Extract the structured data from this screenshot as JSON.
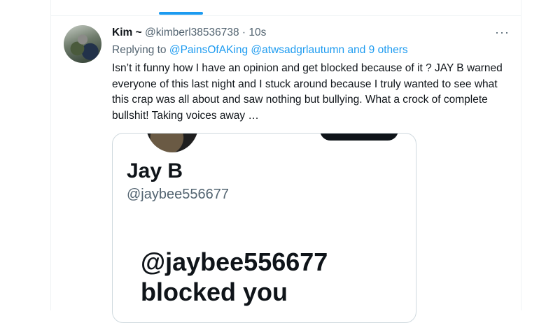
{
  "tweet": {
    "author_name": "Kim ~",
    "author_handle": "@kimberl38536738",
    "separator": " · ",
    "timestamp": "10s",
    "more_label": "···",
    "replying_prefix": "Replying to",
    "replying_to_1": "@PainsOfAKing",
    "replying_to_2": "@atwsadgrlautumn",
    "replying_others": "and 9 others",
    "text": "Isn’t it funny how I have an opinion and get blocked because of it ? JAY B warned everyone of this last night and I stuck around because I truly wanted to see what this crap was all about and saw nothing but bullying. What a crock of complete bullshit! Taking voices away …"
  },
  "media": {
    "profile_name": "Jay B",
    "profile_handle": "@jaybee556677",
    "blocked_handle": "@jaybee556677",
    "blocked_text": "blocked you"
  },
  "colors": {
    "accent": "#1d9bf0",
    "text": "#0f1419",
    "secondary": "#536471",
    "border": "#cfd9de"
  }
}
